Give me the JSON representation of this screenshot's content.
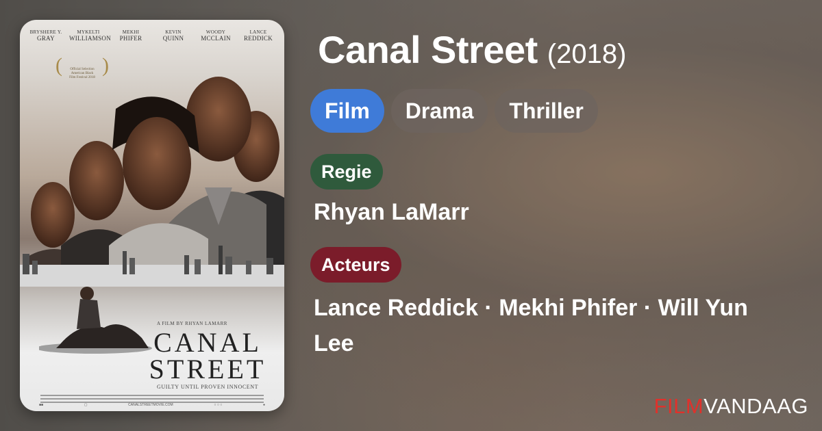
{
  "poster": {
    "cast": [
      {
        "first": "BRYSHERE Y.",
        "last": "GRAY"
      },
      {
        "first": "MYKELTI",
        "last": "WILLIAMSON"
      },
      {
        "first": "MEKHI",
        "last": "PHIFER"
      },
      {
        "first": "KEVIN",
        "last": "QUINN"
      },
      {
        "first": "WOODY",
        "last": "MCCLAIN"
      },
      {
        "first": "LANCE",
        "last": "REDDICK"
      }
    ],
    "laurel_text": "Official Selection American Black Film Festival 2018",
    "film_by": "A FILM BY RHYAN LAMARR",
    "title_line1": "CANAL",
    "title_line2": "STREET",
    "tagline": "GUILTY UNTIL PROVEN INNOCENT",
    "website": "CANALSTREETMOVIE.COM"
  },
  "movie": {
    "title": "Canal Street",
    "year": "(2018)",
    "genres": [
      "Film",
      "Drama",
      "Thriller"
    ],
    "regie_label": "Regie",
    "director": "Rhyan LaMarr",
    "acteurs_label": "Acteurs",
    "actors": "Lance Reddick · Mekhi Phifer · Will Yun Lee"
  },
  "brand": {
    "part1": "FILM",
    "part2": "VANDAAG"
  },
  "colors": {
    "film_chip": "#3f7bd8",
    "regie_badge": "#2f5a3c",
    "acteurs_badge": "#7b1c2a",
    "brand_red": "#e0312b"
  }
}
